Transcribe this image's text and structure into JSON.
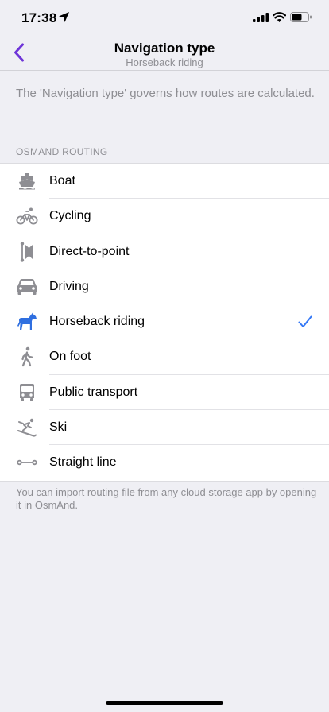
{
  "status_bar": {
    "time": "17:38"
  },
  "nav": {
    "title": "Navigation type",
    "subtitle": "Horseback riding"
  },
  "description": "The 'Navigation type' governs how routes are calculated.",
  "section_header": "OSMAND ROUTING",
  "items": [
    {
      "label": "Boat",
      "icon": "boat-icon",
      "selected": false
    },
    {
      "label": "Cycling",
      "icon": "bicycle-icon",
      "selected": false
    },
    {
      "label": "Direct-to-point",
      "icon": "direct-to-point-icon",
      "selected": false
    },
    {
      "label": "Driving",
      "icon": "car-icon",
      "selected": false
    },
    {
      "label": "Horseback riding",
      "icon": "horse-icon",
      "selected": true
    },
    {
      "label": "On foot",
      "icon": "pedestrian-icon",
      "selected": false
    },
    {
      "label": "Public transport",
      "icon": "bus-icon",
      "selected": false
    },
    {
      "label": "Ski",
      "icon": "ski-icon",
      "selected": false
    },
    {
      "label": "Straight line",
      "icon": "straight-line-icon",
      "selected": false
    }
  ],
  "footer": "You can import routing file from any cloud storage app by opening it in OsmAnd.",
  "colors": {
    "accent": "#6e34d8",
    "selected_icon": "#2f6fe0",
    "checkmark": "#3478f6",
    "icon_gray": "#8e8e93"
  }
}
